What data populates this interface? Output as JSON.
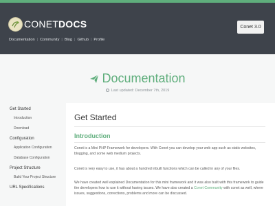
{
  "colors": {
    "brand_green": "#5fae7c",
    "header_bg": "#3e434b"
  },
  "header": {
    "brand_light": "CONET",
    "brand_bold": "DOCS",
    "version_button": "Conet 3.0",
    "nav": [
      "Documentation",
      "Community",
      "Blog",
      "Github",
      "Profile"
    ]
  },
  "hero": {
    "title": "Documentation",
    "last_updated": "Last updated: December 7th, 2019",
    "icons": [
      "paper-plane-icon",
      "clock-icon"
    ]
  },
  "sidebar": [
    {
      "section": "Get Started",
      "items": [
        "Introduction",
        "Download"
      ]
    },
    {
      "section": "Configuration",
      "items": [
        "Application Configuration",
        "Database Configuration"
      ]
    },
    {
      "section": "Project Structure",
      "items": [
        "Build Your Project Structure"
      ]
    },
    {
      "section": "URL Specifications",
      "items": []
    }
  ],
  "main": {
    "title": "Get Started",
    "section_title": "Introduction",
    "p1": "Conet is a Mini PHP Framework for developers. With Conet you can develop your web app such as static websites, blogging, and some web medium projects.",
    "p2": "Conet is very easy to use, it has about a hundred inbuilt functions which can be called in any of your files.",
    "p3_before": "We have created well explained Documentation for this mini framework and it was also built with this framework to guide the developers how to use it without having issues. We have also created a",
    "p3_link": "Conet Community",
    "p3_after": "with conet as well, where issues, suggestions, corrections, problems and more can be discussed."
  }
}
